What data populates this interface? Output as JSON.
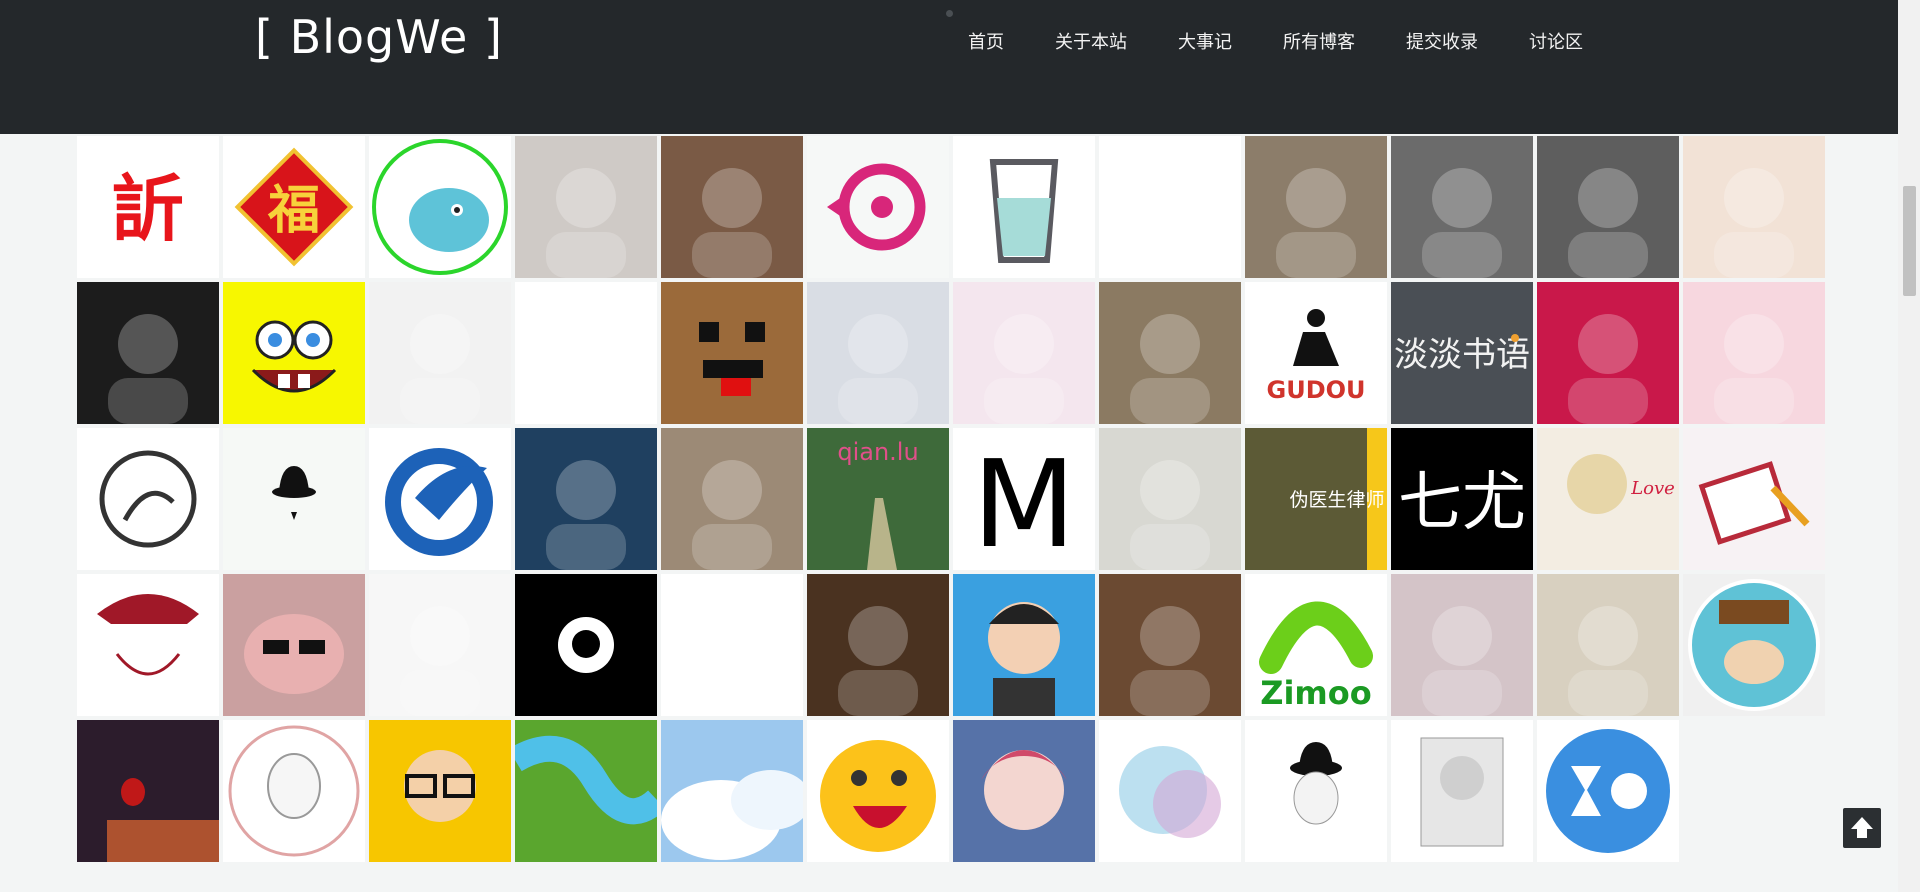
{
  "header": {
    "brand": "[ BlogWe ]",
    "nav": [
      "首页",
      "关于本站",
      "大事记",
      "所有博客",
      "提交收录",
      "讨论区"
    ]
  },
  "avatars": [
    {
      "icon": "red-calligraphy-logo-icon",
      "bg": "#ffffff"
    },
    {
      "icon": "fu-new-year-diamond-icon",
      "bg": "#ffffff"
    },
    {
      "icon": "blue-whale-yu-icon",
      "bg": "#ffffff"
    },
    {
      "icon": "white-cat-photo-icon",
      "bg": "#cfcac6"
    },
    {
      "icon": "man-glasses-photo-icon",
      "bg": "#7a5a45"
    },
    {
      "icon": "pink-speech-circle-icon",
      "bg": "#f6f8f7"
    },
    {
      "icon": "water-glass-icon",
      "bg": "#ffffff"
    },
    {
      "icon": "cartoon-boy-icon",
      "bg": "#ffffff"
    },
    {
      "icon": "man-portrait-photo-icon",
      "bg": "#8c7d6a"
    },
    {
      "icon": "bw-portrait-photo-icon",
      "bg": "#6b6b6b"
    },
    {
      "icon": "polar-bear-icon",
      "bg": "#5e5e5e"
    },
    {
      "icon": "girl-hat-illustration-icon",
      "bg": "#f2e2d6"
    },
    {
      "icon": "cat-paws-photo-icon",
      "bg": "#1c1c1c"
    },
    {
      "icon": "spongebob-icon",
      "bg": "#f7f700"
    },
    {
      "icon": "sketch-face-icon",
      "bg": "#f2f2f2"
    },
    {
      "icon": "deer-illustration-icon",
      "bg": "#ffffff"
    },
    {
      "icon": "pixel-face-icon",
      "bg": "#9b6a3a"
    },
    {
      "icon": "anime-silver-hair-icon",
      "bg": "#d9dde4"
    },
    {
      "icon": "anime-girl-red-hat-icon",
      "bg": "#f4e6ee"
    },
    {
      "icon": "couple-photo-icon",
      "bg": "#8b7a62"
    },
    {
      "icon": "gudou-logo-icon",
      "bg": "#ffffff"
    },
    {
      "icon": "calligraphy-dark-icon",
      "bg": "#4a4f55"
    },
    {
      "icon": "white-cup-red-icon",
      "bg": "#c9184a"
    },
    {
      "icon": "cartoon-couple-icon",
      "bg": "#f7d7df"
    },
    {
      "icon": "line-cat-icon",
      "bg": "#ffffff"
    },
    {
      "icon": "bell-hat-icon",
      "bg": "#f6f9f6"
    },
    {
      "icon": "blue-bird-logo-icon",
      "bg": "#ffffff"
    },
    {
      "icon": "dark-sky-photo-icon",
      "bg": "#1f4060"
    },
    {
      "icon": "christmas-collage-icon",
      "bg": "#9c8a76"
    },
    {
      "icon": "qian-lu-couple-road-icon",
      "bg": "#3e6a3a",
      "text": "qian.lu"
    },
    {
      "icon": "letter-m-icon",
      "bg": "#ffffff",
      "text": "M"
    },
    {
      "icon": "anime-boy-grey-icon",
      "bg": "#d8d8d2"
    },
    {
      "icon": "fake-doctor-cat-icon",
      "bg": "#5c5a36",
      "text": "伪医生律师"
    },
    {
      "icon": "calligraphy-white-icon",
      "bg": "#000000"
    },
    {
      "icon": "anime-love-icon",
      "bg": "#f3ede2",
      "text": "Love"
    },
    {
      "icon": "notebook-pencil-icon",
      "bg": "#f7f2f4"
    },
    {
      "icon": "luffy-sketch-icon",
      "bg": "#ffffff"
    },
    {
      "icon": "pig-sunglasses-icon",
      "bg": "#caa0a0"
    },
    {
      "icon": "sketch-man-back-icon",
      "bg": "#f7f7f7"
    },
    {
      "icon": "github-icon",
      "bg": "#000000"
    },
    {
      "icon": "anime-messy-hair-icon",
      "bg": "#ffffff"
    },
    {
      "icon": "toy-figure-photo-icon",
      "bg": "#4a3220"
    },
    {
      "icon": "cartoon-man-blue-icon",
      "bg": "#3aa0e0"
    },
    {
      "icon": "masked-man-photo-icon",
      "bg": "#6b4a32"
    },
    {
      "icon": "zimoo-caterpillar-icon",
      "bg": "#ffffff",
      "text": "Zimoo"
    },
    {
      "icon": "anime-boy-street-icon",
      "bg": "#d4c4c8"
    },
    {
      "icon": "anime-boy-profile-icon",
      "bg": "#d8d0c0"
    },
    {
      "icon": "paul-frank-monkey-icon",
      "bg": "#f0f0f0"
    },
    {
      "icon": "lanterns-balloon-photo-icon",
      "bg": "#2c1c2c"
    },
    {
      "icon": "old-man-sketch-icon",
      "bg": "#ffffff"
    },
    {
      "icon": "glasses-boy-yellow-icon",
      "bg": "#f7c600"
    },
    {
      "icon": "river-map-icon",
      "bg": "#5aa62e"
    },
    {
      "icon": "clouds-sky-icon",
      "bg": "#9cc8ee"
    },
    {
      "icon": "qq-penguin-laugh-icon",
      "bg": "#ffffff"
    },
    {
      "icon": "anime-pink-hair-icon",
      "bg": "#5672a8"
    },
    {
      "icon": "watercolor-splash-icon",
      "bg": "#ffffff"
    },
    {
      "icon": "chaplin-icon",
      "bg": "#ffffff"
    },
    {
      "icon": "man-pencil-portrait-icon",
      "bg": "#ffffff"
    },
    {
      "icon": "xo-blue-circle-icon",
      "bg": "#ffffff"
    }
  ]
}
